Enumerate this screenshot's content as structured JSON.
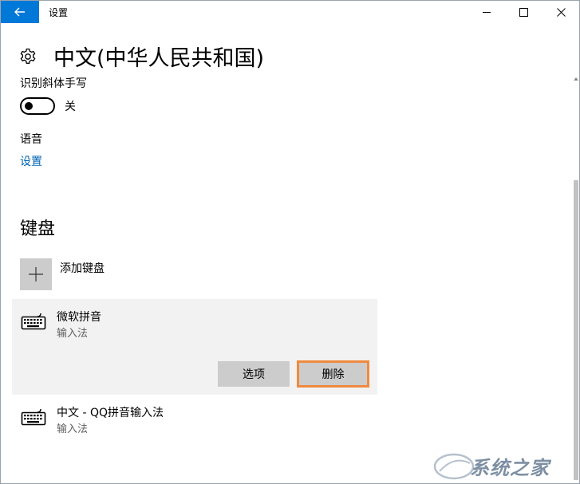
{
  "window": {
    "title": "设置",
    "icons": {
      "back": "back-arrow-icon",
      "minimize": "minimize-icon",
      "maximize": "maximize-icon",
      "close": "close-icon"
    }
  },
  "page": {
    "icon": "gear-icon",
    "title": "中文(中华人民共和国)"
  },
  "handwriting": {
    "label": "识别斜体手写",
    "toggle_state": "关"
  },
  "speech": {
    "label": "语音",
    "settings_link": "设置"
  },
  "keyboards": {
    "heading": "键盘",
    "add_label": "添加键盘",
    "add_icon": "plus-icon",
    "items": [
      {
        "name": "微软拼音",
        "type": "输入法",
        "icon": "keyboard-icon"
      },
      {
        "name": "中文 - QQ拼音输入法",
        "type": "输入法",
        "icon": "keyboard-icon"
      }
    ],
    "options_label": "选项",
    "remove_label": "删除"
  },
  "watermark": {
    "text": "系统之家"
  },
  "colors": {
    "accent": "#0078d7",
    "link": "#0063b1",
    "highlight_border": "#ef8a3e",
    "button": "#cccccc",
    "selected_row": "#f2f2f2"
  }
}
